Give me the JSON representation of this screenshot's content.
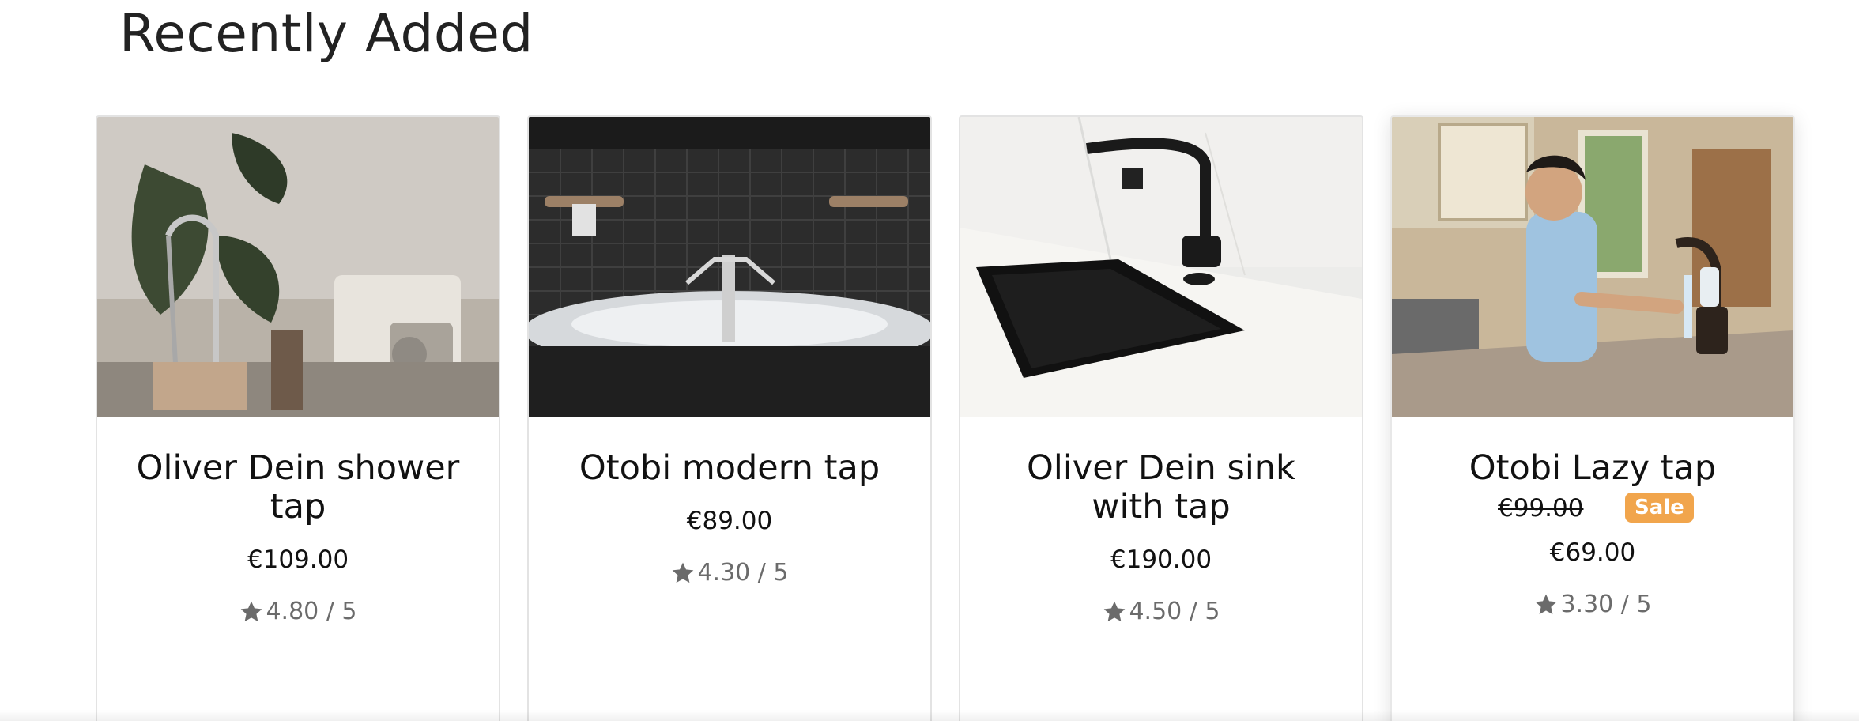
{
  "section": {
    "title": "Recently Added"
  },
  "products": [
    {
      "title": "Oliver Dein shower tap",
      "price": "€109.00",
      "rating": "4.80 / 5",
      "image": "kitchen shower tap photo"
    },
    {
      "title": "Otobi modern tap",
      "price": "€89.00",
      "rating": "4.30 / 5",
      "image": "bathroom tap photo"
    },
    {
      "title": "Oliver Dein sink with tap",
      "price": "€190.00",
      "rating": "4.50 / 5",
      "image": "black sink photo"
    },
    {
      "title": "Otobi Lazy tap",
      "old_price": "€99.00",
      "sale_label": "Sale",
      "price": "€69.00",
      "rating": "3.30 / 5",
      "image": "boy washing hands photo"
    }
  ],
  "colors": {
    "sale": "#f1a54c",
    "star": "#6b6b6b"
  }
}
